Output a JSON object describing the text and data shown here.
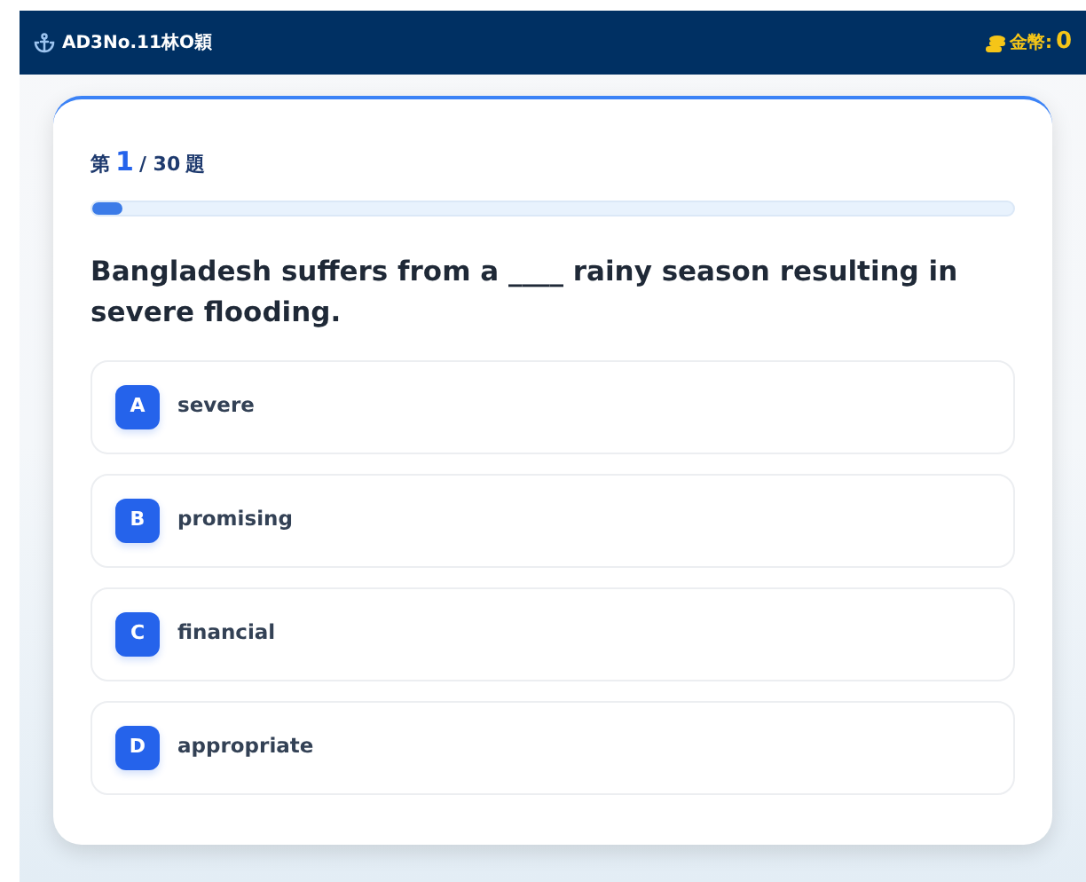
{
  "header": {
    "user": "AD3No.11林O穎",
    "coins_label": "金幣:",
    "coins": "0"
  },
  "progress": {
    "prefix": "第",
    "current": "1",
    "total": "/ 30",
    "suffix": "題",
    "level": 0.033
  },
  "question": "Bangladesh suffers from a ____ rainy season resulting in severe flooding.",
  "options": [
    {
      "letter": "A",
      "text": "severe",
      "selected": false
    },
    {
      "letter": "B",
      "text": "promising",
      "selected": false
    },
    {
      "letter": "C",
      "text": "financial",
      "selected": false
    },
    {
      "letter": "D",
      "text": "appropriate",
      "selected": false
    }
  ]
}
